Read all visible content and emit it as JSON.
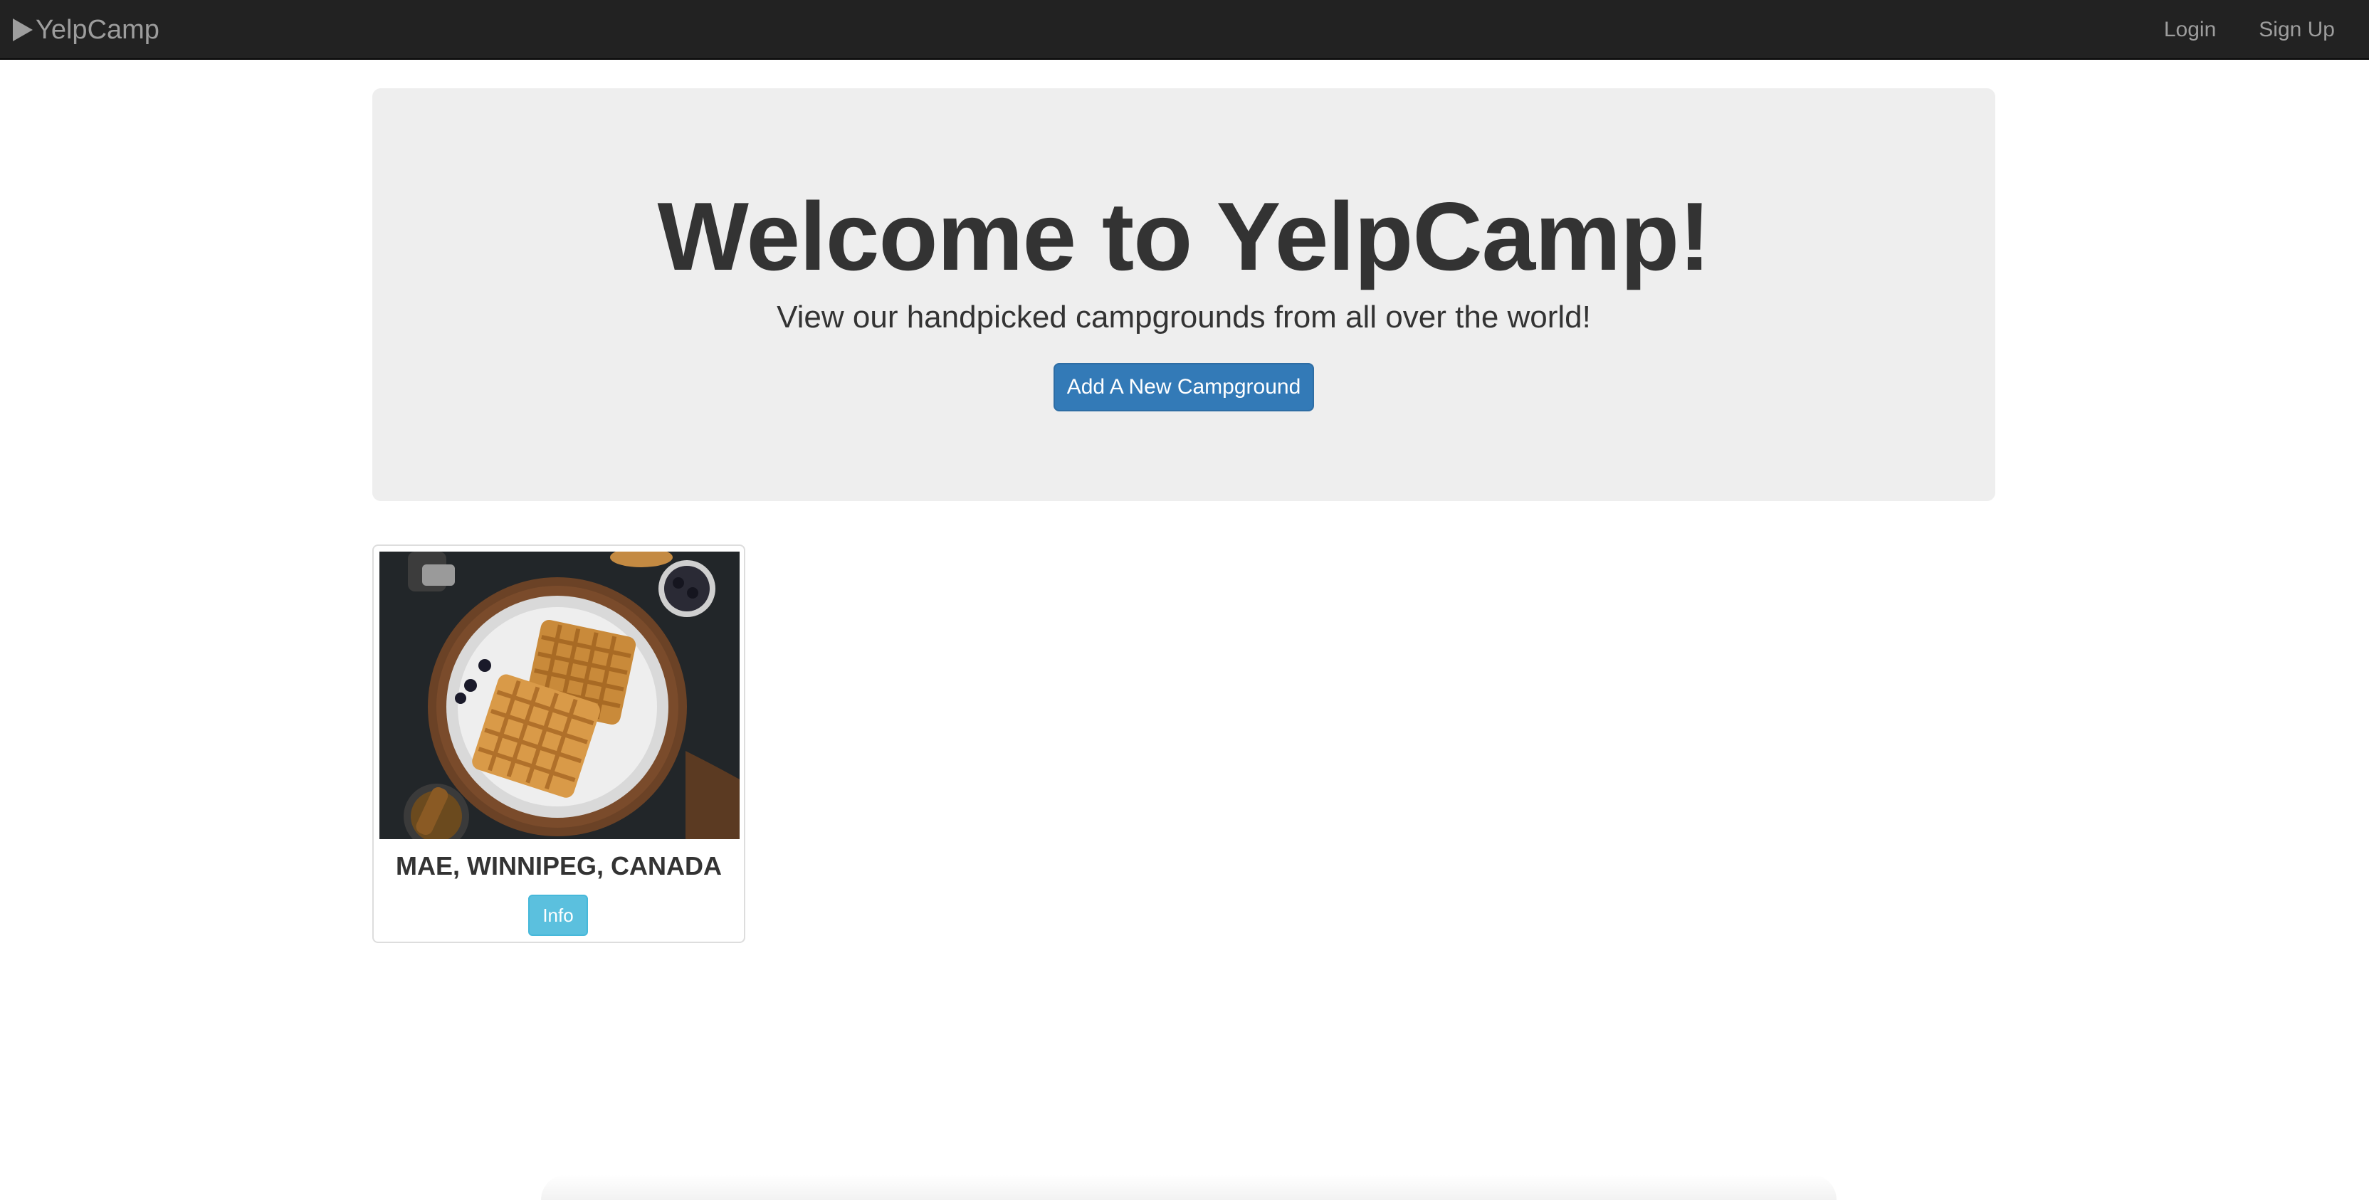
{
  "navbar": {
    "brand": "YelpCamp",
    "brand_icon": "play-icon",
    "links": [
      "Login",
      "Sign Up"
    ]
  },
  "jumbotron": {
    "title": "Welcome to YelpCamp!",
    "subtitle": "View our handpicked campgrounds from all over the world!",
    "button_label": "Add A New Campground"
  },
  "campgrounds": [
    {
      "name": "MAE, WINNIPEG, CANADA",
      "button_label": "Info"
    }
  ],
  "colors": {
    "navbar_bg": "#222222",
    "navbar_text": "#9d9d9d",
    "jumbotron_bg": "#eeeeee",
    "primary": "#337ab7",
    "info": "#5bc0de"
  }
}
